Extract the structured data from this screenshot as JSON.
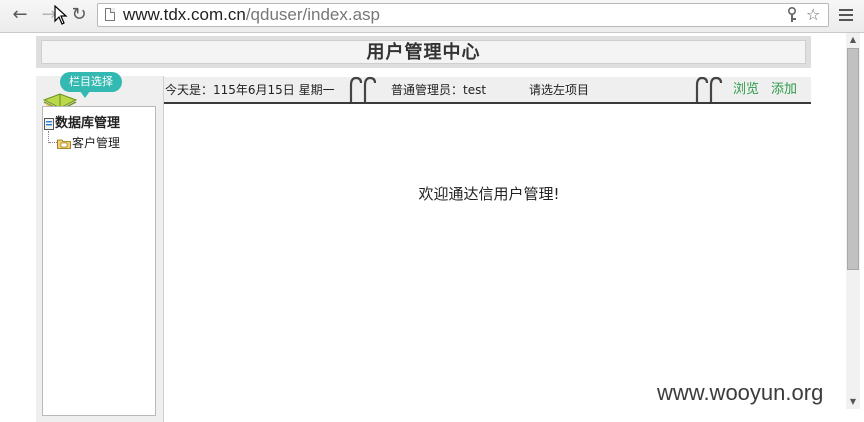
{
  "browser": {
    "url_host": "www.tdx.com.cn",
    "url_path": "/qduser/index.asp",
    "icons": [
      "back-arrow-icon",
      "forward-arrow-icon",
      "reload-icon",
      "page-icon",
      "key-icon",
      "star-icon",
      "menu-icon"
    ]
  },
  "header": {
    "title": "用户管理中心"
  },
  "sidebar": {
    "tab_label": "栏目选择",
    "tree": {
      "root_label": "数据库管理",
      "children": [
        {
          "label": "客户管理"
        }
      ]
    }
  },
  "toolbar": {
    "date_text": "今天是：115年6月15日 星期一",
    "user_text": "普通管理员：test",
    "hint_text": "请选左项目",
    "browse_label": "浏览",
    "add_label": "添加",
    "link_color": "#2e9b4b"
  },
  "main": {
    "welcome_text": "欢迎通达信用户管理!"
  },
  "watermark": {
    "text": "www.wooyun.org"
  }
}
